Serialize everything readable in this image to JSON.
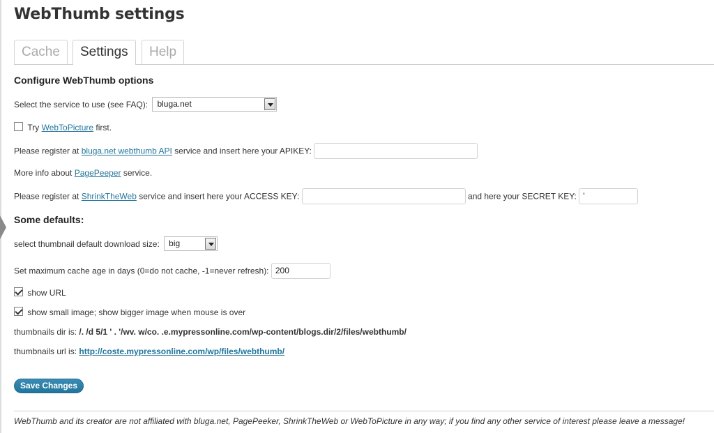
{
  "page": {
    "title": "WebThumb settings"
  },
  "tabs": [
    {
      "label": "Cache",
      "active": false
    },
    {
      "label": "Settings",
      "active": true
    },
    {
      "label": "Help",
      "active": false
    }
  ],
  "configure": {
    "heading": "Configure WebThumb options",
    "service_label": "Select the service to use (see FAQ):",
    "service_value": "bluga.net",
    "try_prefix": "Try",
    "try_link": "WebToPicture",
    "try_suffix": "first.",
    "try_checked": false,
    "bluga_prefix": "Please register at",
    "bluga_link": "bluga.net webthumb API",
    "bluga_suffix": "service and insert here your APIKEY:",
    "apikey_value": "",
    "pagepeeper_prefix": "More info about",
    "pagepeeper_link": "PagePeeper",
    "pagepeeper_suffix": "service.",
    "stw_prefix": "Please register at",
    "stw_link": "ShrinkTheWeb",
    "stw_middle": "service and insert here your ACCESS KEY:",
    "access_key_value": "",
    "stw_secret_label": "and here your SECRET KEY:",
    "secret_key_value": "'"
  },
  "defaults": {
    "heading": "Some defaults:",
    "size_label": "select thumbnail default download size:",
    "size_value": "big",
    "cache_age_label": "Set maximum cache age in days (0=do not cache, -1=never refresh):",
    "cache_age_value": "200",
    "show_url_label": "show URL",
    "show_url_checked": true,
    "show_small_label": "show small image; show bigger image when mouse is over",
    "show_small_checked": true,
    "dir_label": "thumbnails dir is:",
    "dir_value": "/.   /d   5/1  '  .  '/wv. w/co. .e.mypressonline.com/wp-content/blogs.dir/2/files/webthumb/",
    "url_label": "thumbnails url is:",
    "url_value": "http://coste.mypressonline.com/wp/files/webthumb/"
  },
  "actions": {
    "save_label": "Save Changes"
  },
  "footer": {
    "note": "WebThumb and its creator are not affiliated with bluga.net, PagePeeker, ShrinkTheWeb or WebToPicture in any way; if you find any other service of interest please leave a message!"
  }
}
